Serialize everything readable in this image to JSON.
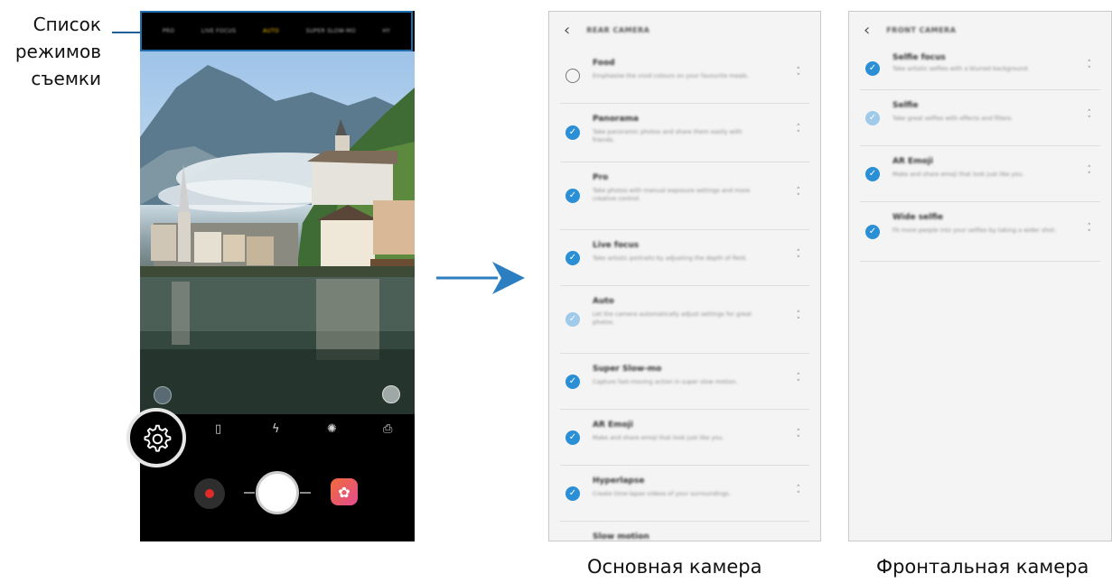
{
  "callout": {
    "line1": "Список",
    "line2": "режимов",
    "line3": "съемки"
  },
  "camera": {
    "modes": [
      "PRO",
      "LIVE FOCUS",
      "AUTO",
      "SUPER SLOW-MO",
      "HY"
    ],
    "active_mode": "AUTO",
    "toolbar_icons": [
      "settings-icon",
      "aspect-ratio-icon",
      "flash-off-icon",
      "filter-icon",
      "switch-camera-icon"
    ]
  },
  "rear_panel": {
    "title": "REAR CAMERA",
    "items": [
      {
        "name": "Food",
        "desc": "Emphasise the vivid colours on your favourite meals.",
        "state": "unchecked"
      },
      {
        "name": "Panorama",
        "desc": "Take panoramic photos and share them easily with friends.",
        "state": "checked"
      },
      {
        "name": "Pro",
        "desc": "Take photos with manual exposure settings and more creative control.",
        "state": "checked"
      },
      {
        "name": "Live focus",
        "desc": "Take artistic portraits by adjusting the depth of field.",
        "state": "checked"
      },
      {
        "name": "Auto",
        "desc": "Let the camera automatically adjust settings for great photos.",
        "state": "light"
      },
      {
        "name": "Super Slow-mo",
        "desc": "Capture fast-moving action in super slow motion.",
        "state": "checked"
      },
      {
        "name": "AR Emoji",
        "desc": "Make and share emoji that look just like you.",
        "state": "checked"
      },
      {
        "name": "Hyperlapse",
        "desc": "Create time-lapse videos of your surroundings.",
        "state": "checked"
      },
      {
        "name": "Slow motion",
        "desc": "",
        "state": "checked"
      }
    ]
  },
  "front_panel": {
    "title": "FRONT CAMERA",
    "items": [
      {
        "name": "Selfie focus",
        "desc": "Take artistic selfies with a blurred background.",
        "state": "checked"
      },
      {
        "name": "Selfie",
        "desc": "Take great selfies with effects and filters.",
        "state": "light"
      },
      {
        "name": "AR Emoji",
        "desc": "Make and share emoji that look just like you.",
        "state": "checked"
      },
      {
        "name": "Wide selfie",
        "desc": "Fit more people into your selfies by taking a wider shot.",
        "state": "checked"
      }
    ]
  },
  "captions": {
    "rear": "Основная камера",
    "front": "Фронтальная камера"
  },
  "colors": {
    "accent": "#2a8fd4",
    "highlight_box": "#1f6fae",
    "arrow": "#2b7fc1"
  }
}
